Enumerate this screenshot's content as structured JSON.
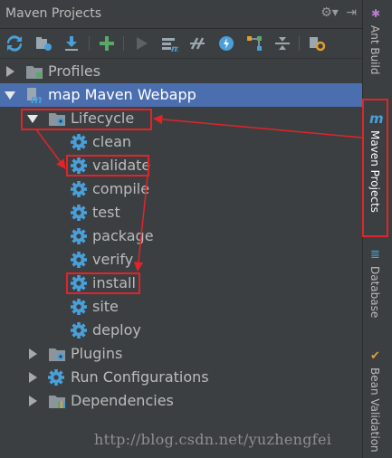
{
  "panel": {
    "title": "Maven Projects",
    "title_icons": [
      "gear-icon",
      "hide-icon"
    ]
  },
  "toolbar": {
    "buttons": [
      "reimport-icon",
      "generate-sources-icon",
      "download-icon",
      "add-icon",
      "run-icon",
      "execute-goal-icon",
      "toggle-offline-icon",
      "skip-tests-icon",
      "show-dependencies-icon",
      "collapse-all-icon",
      "settings-icon"
    ]
  },
  "tree": {
    "profiles": "Profiles",
    "project": "map Maven Webapp",
    "lifecycle": "Lifecycle",
    "goals": [
      "clean",
      "validate",
      "compile",
      "test",
      "package",
      "verify",
      "install",
      "site",
      "deploy"
    ],
    "plugins": "Plugins",
    "run_configurations": "Run Configurations",
    "dependencies": "Dependencies"
  },
  "sidebar": {
    "tabs": [
      "Ant Build",
      "Maven Projects",
      "Database",
      "Bean Validation"
    ]
  },
  "watermark": "http://blog.csdn.net/yuzhengfei",
  "colors": {
    "selection": "#4b6eaf",
    "highlight": "#e0242a",
    "gear": "#4a9fd8"
  }
}
